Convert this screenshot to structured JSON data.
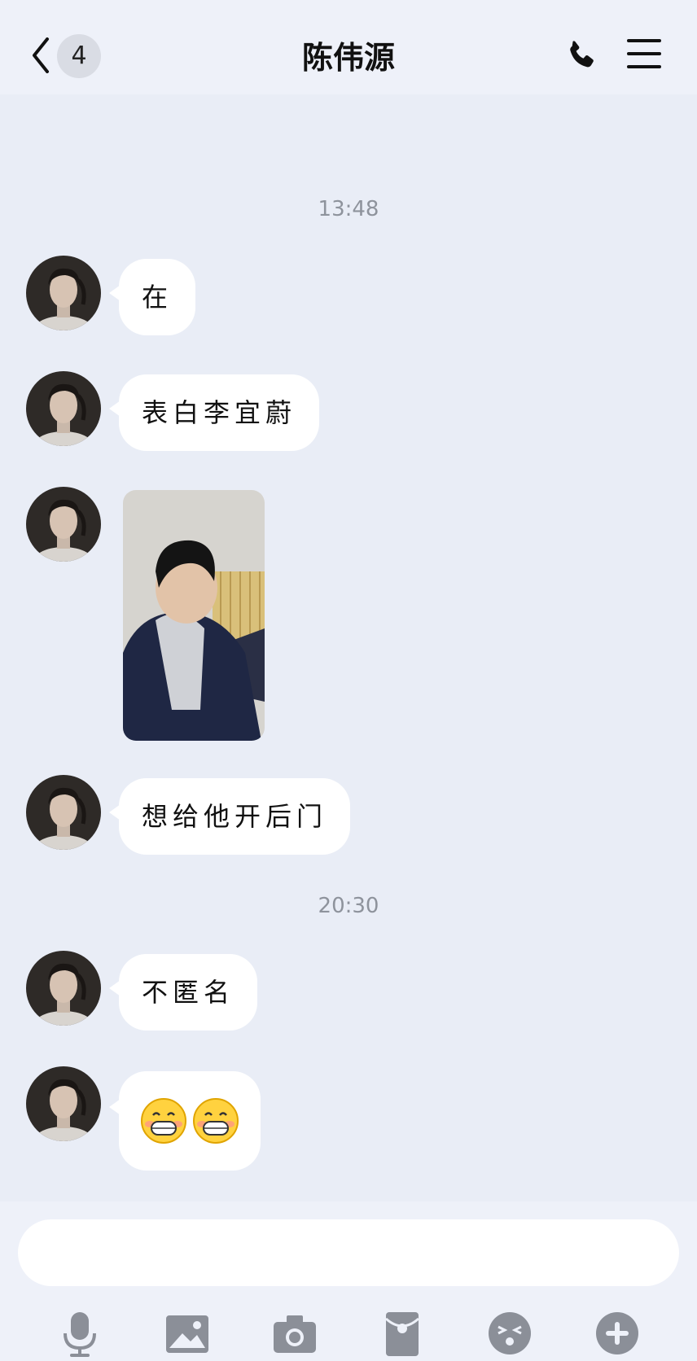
{
  "header": {
    "back_badge": "4",
    "title": "陈伟源"
  },
  "messages": [
    {
      "type": "timestamp",
      "text": "13:48"
    },
    {
      "type": "text",
      "text": "在"
    },
    {
      "type": "text",
      "text": "表白李宜蔚"
    },
    {
      "type": "image"
    },
    {
      "type": "text",
      "text": "想给他开后门"
    },
    {
      "type": "timestamp",
      "text": "20:30"
    },
    {
      "type": "text",
      "text": "不匿名"
    },
    {
      "type": "emoji",
      "emoji": [
        "grin-emoji",
        "grin-emoji"
      ]
    }
  ],
  "input": {
    "value": "",
    "placeholder": ""
  },
  "toolbar": {
    "icons": [
      "microphone-icon",
      "image-icon",
      "camera-icon",
      "red-packet-icon",
      "emoji-icon",
      "plus-icon"
    ]
  },
  "colors": {
    "background": "#e9edf6",
    "bubble": "#ffffff",
    "icon_gray": "#8b8f98",
    "timestamp": "#8e939c"
  }
}
